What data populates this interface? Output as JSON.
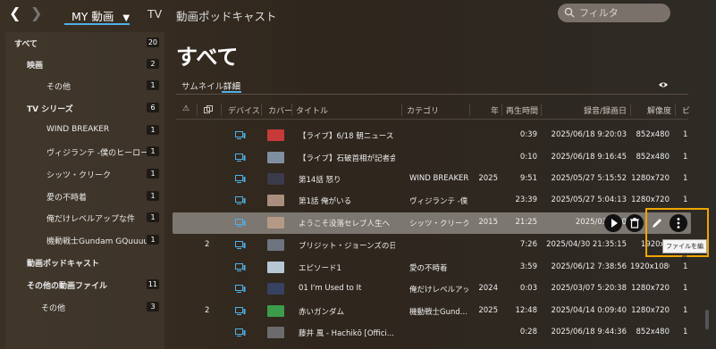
{
  "topbar": {
    "tabs": [
      "MY 動画",
      "TV",
      "動画ポッドキャスト"
    ],
    "filter_placeholder": "フィルタ"
  },
  "sidebar": {
    "items": [
      {
        "label": "すべて",
        "count": "20"
      },
      {
        "label": "映画",
        "count": "2"
      },
      {
        "label": "その他",
        "count": "1"
      },
      {
        "label": "TV シリーズ",
        "count": "6"
      },
      {
        "label": "WIND BREAKER",
        "count": "1"
      },
      {
        "label": "ヴィジランテ -僕のヒーローアカデ...",
        "count": "1"
      },
      {
        "label": "シッツ・クリーク",
        "count": "1"
      },
      {
        "label": "愛の不時着",
        "count": "1"
      },
      {
        "label": "俺だけレベルアップな件",
        "count": "1"
      },
      {
        "label": "機動戦士Gundam GQuuuuu...",
        "count": "1"
      },
      {
        "label": "動画ポッドキャスト",
        "count": ""
      },
      {
        "label": "その他の動画ファイル",
        "count": "11"
      },
      {
        "label": "その他",
        "count": "3"
      }
    ]
  },
  "main": {
    "title": "すべて",
    "view_tabs": [
      "サムネイル",
      "詳細"
    ],
    "columns": [
      "⚠",
      "",
      "デバイス",
      "カバー",
      "タイトル",
      "カテゴリ",
      "年",
      "再生時間",
      "録音/録画日",
      "解像度",
      "ビ"
    ],
    "rows": [
      {
        "c1": "",
        "title": "【ライブ】6/18 朝ニュースまと...",
        "category": "",
        "year": "",
        "duration": "0:39",
        "date": "2025/06/18 9:20:03",
        "res": "852x480",
        "last": "1"
      },
      {
        "c1": "",
        "title": "【ライブ】石破首相が記者会...",
        "category": "",
        "year": "",
        "duration": "0:10",
        "date": "2025/06/18 9:16:45",
        "res": "852x480",
        "last": "1"
      },
      {
        "c1": "",
        "title": "第14話 怒り",
        "category": "WIND BREAKER",
        "year": "2025",
        "duration": "9:51",
        "date": "2025/05/27 5:15:52",
        "res": "1280x720",
        "last": "1"
      },
      {
        "c1": "",
        "title": "第1話 俺がいる",
        "category": "ヴィジランテ -僕...",
        "year": "",
        "duration": "23:39",
        "date": "2025/05/27 5:04:13",
        "res": "1280x720",
        "last": "1"
      },
      {
        "c1": "",
        "title": "ようこそ没落セレブ人生へ",
        "category": "シッツ・クリーク",
        "year": "2015",
        "duration": "21:25",
        "date": "2025/03/06 0",
        "res": "",
        "last": ""
      },
      {
        "c1": "2",
        "title": "ブリジット・ジョーンズの日記...",
        "category": "",
        "year": "",
        "duration": "7:26",
        "date": "2025/04/30 21:35:15",
        "res": "1920x1",
        "last": ""
      },
      {
        "c1": "",
        "title": "エピソード1",
        "category": "愛の不時着",
        "year": "",
        "duration": "3:59",
        "date": "2025/06/12 7:38:56",
        "res": "1920x1080",
        "last": "1"
      },
      {
        "c1": "",
        "title": "01 I'm Used to It",
        "category": "俺だけレベルアッ...",
        "year": "2024",
        "duration": "0:03",
        "date": "2025/03/07 5:20:38",
        "res": "1280x720",
        "last": "1"
      },
      {
        "c1": "2",
        "title": "赤いガンダム",
        "category": "機動戦士Gund...",
        "year": "2025",
        "duration": "12:48",
        "date": "2025/04/14 0:09:40",
        "res": "1280x720",
        "last": "1"
      },
      {
        "c1": "",
        "title": "藤井 風 - Hachikō [Offici...",
        "category": "",
        "year": "",
        "duration": "0:28",
        "date": "2025/06/18 9:44:36",
        "res": "852x480",
        "last": "1"
      }
    ]
  },
  "tooltip": "ファイルを編集",
  "colors": {
    "accent": "#4fb0e8",
    "highlight": "#f0a500",
    "selected_row": "#7d7771"
  }
}
